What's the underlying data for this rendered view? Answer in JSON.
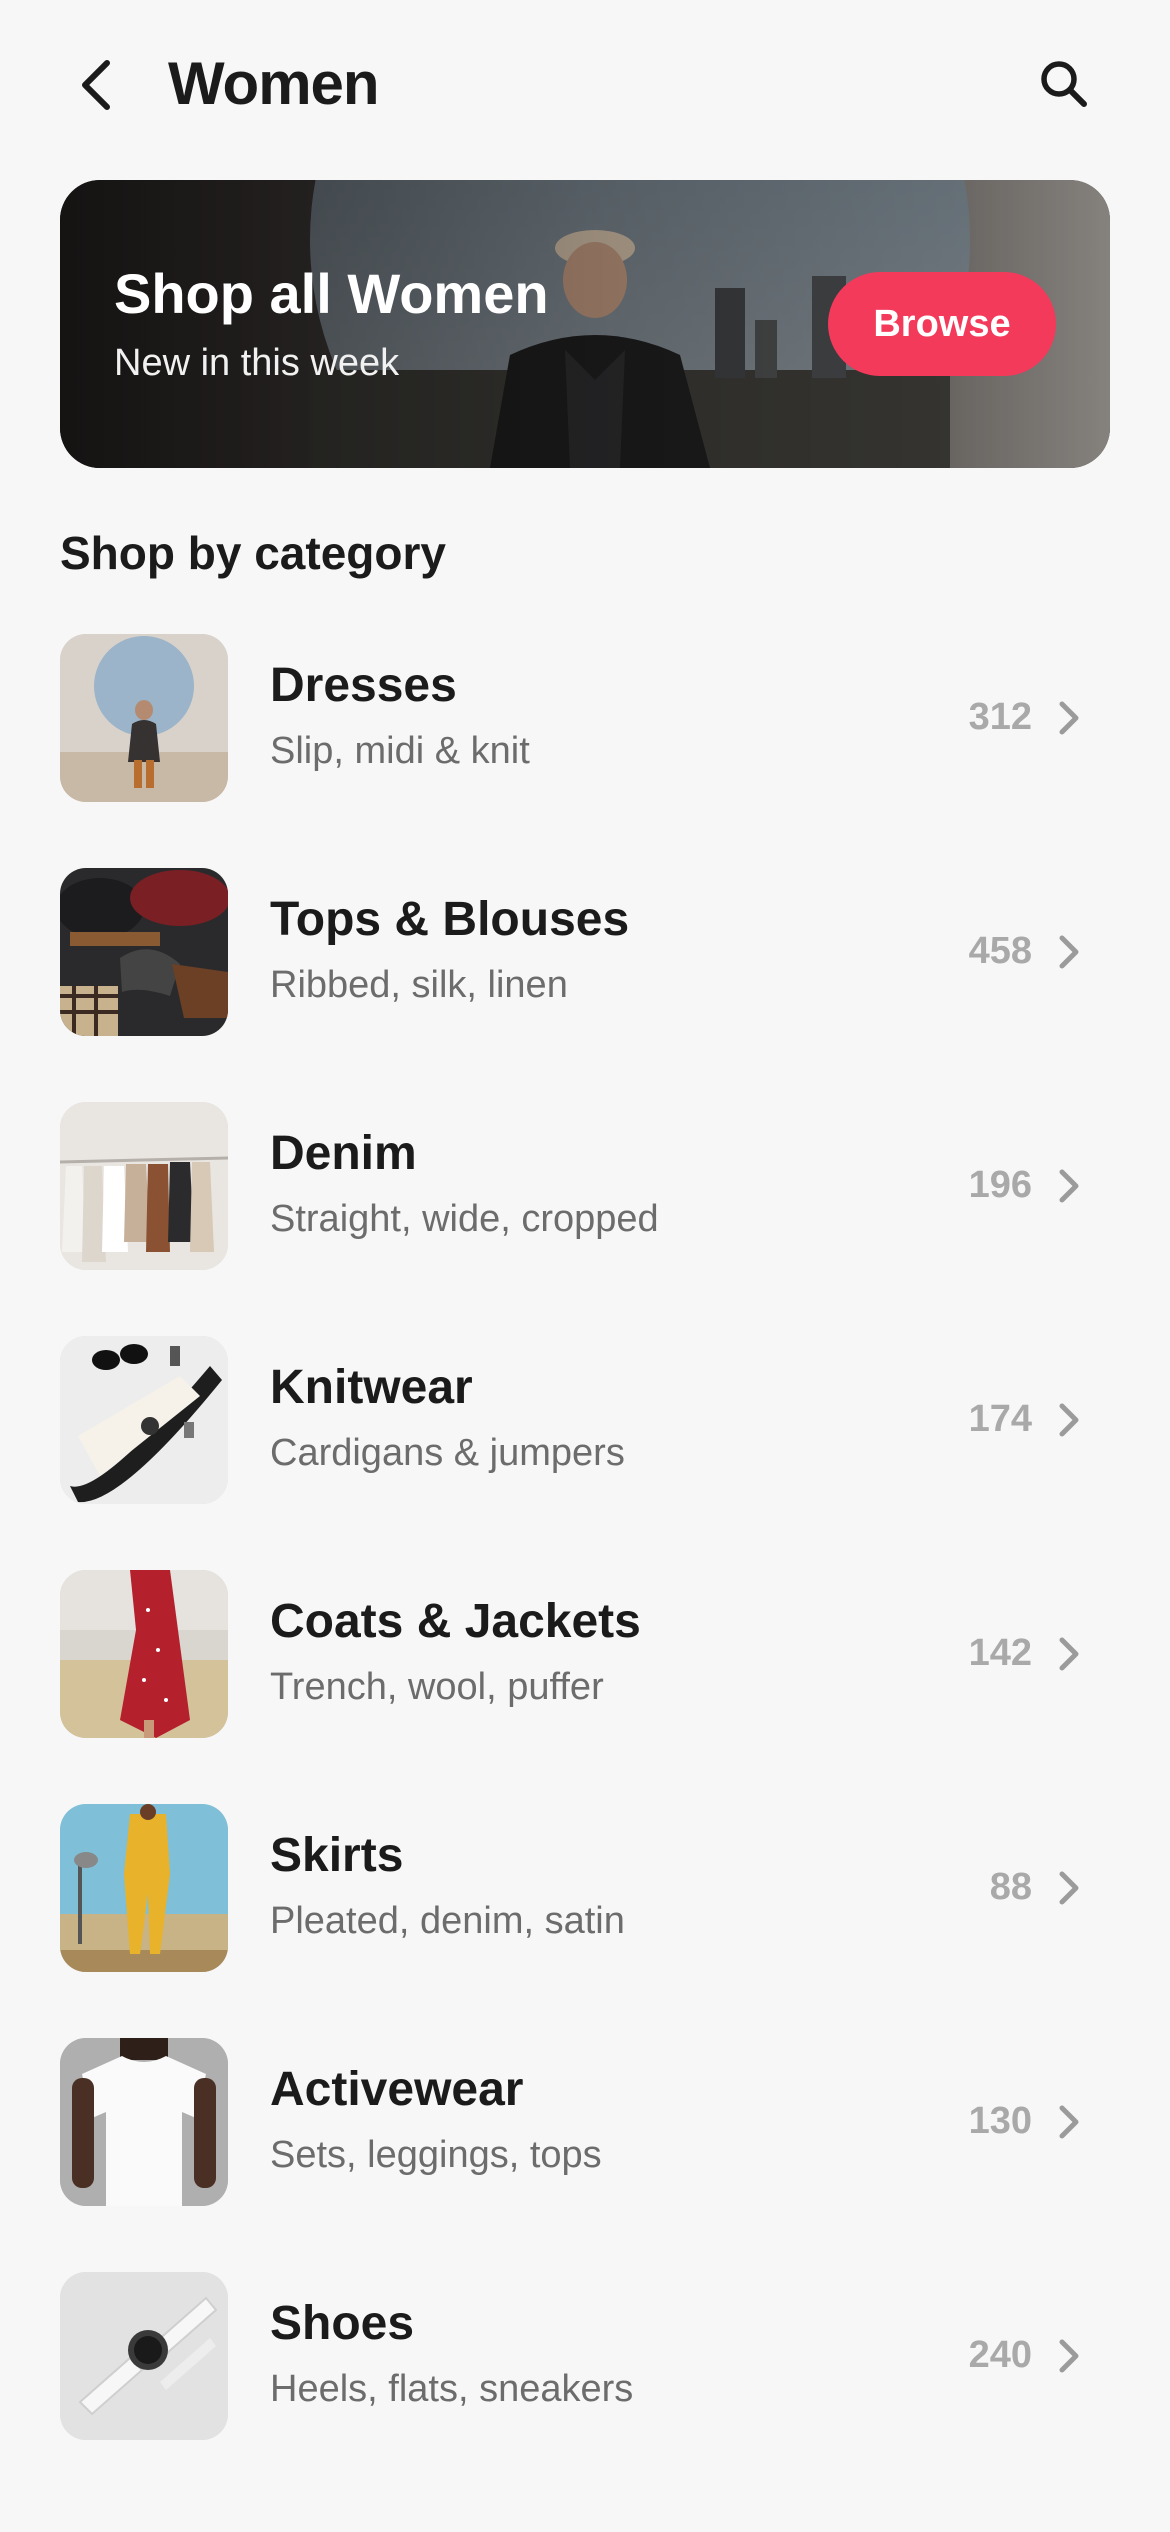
{
  "header": {
    "title": "Women",
    "back_icon": "chevron-left-icon",
    "search_icon": "search-icon"
  },
  "hero": {
    "title": "Shop all Women",
    "subtitle": "New in this week",
    "button_label": "Browse",
    "button_color": "#f33a5b"
  },
  "section": {
    "title": "Shop by category"
  },
  "categories": [
    {
      "name": "Dresses",
      "desc": "Slip, midi & knit",
      "count": "312"
    },
    {
      "name": "Tops & Blouses",
      "desc": "Ribbed, silk, linen",
      "count": "458"
    },
    {
      "name": "Denim",
      "desc": "Straight, wide, cropped",
      "count": "196"
    },
    {
      "name": "Knitwear",
      "desc": "Cardigans & jumpers",
      "count": "174"
    },
    {
      "name": "Coats & Jackets",
      "desc": "Trench, wool, puffer",
      "count": "142"
    },
    {
      "name": "Skirts",
      "desc": "Pleated, denim, satin",
      "count": "88"
    },
    {
      "name": "Activewear",
      "desc": "Sets, leggings, tops",
      "count": "130"
    },
    {
      "name": "Shoes",
      "desc": "Heels, flats, sneakers",
      "count": "240"
    }
  ],
  "colors": {
    "accent": "#f33a5b",
    "text_primary": "#1b1b1b",
    "text_secondary": "#6c6c6c",
    "count": "#a9a9a9",
    "background": "#f7f7f7"
  }
}
